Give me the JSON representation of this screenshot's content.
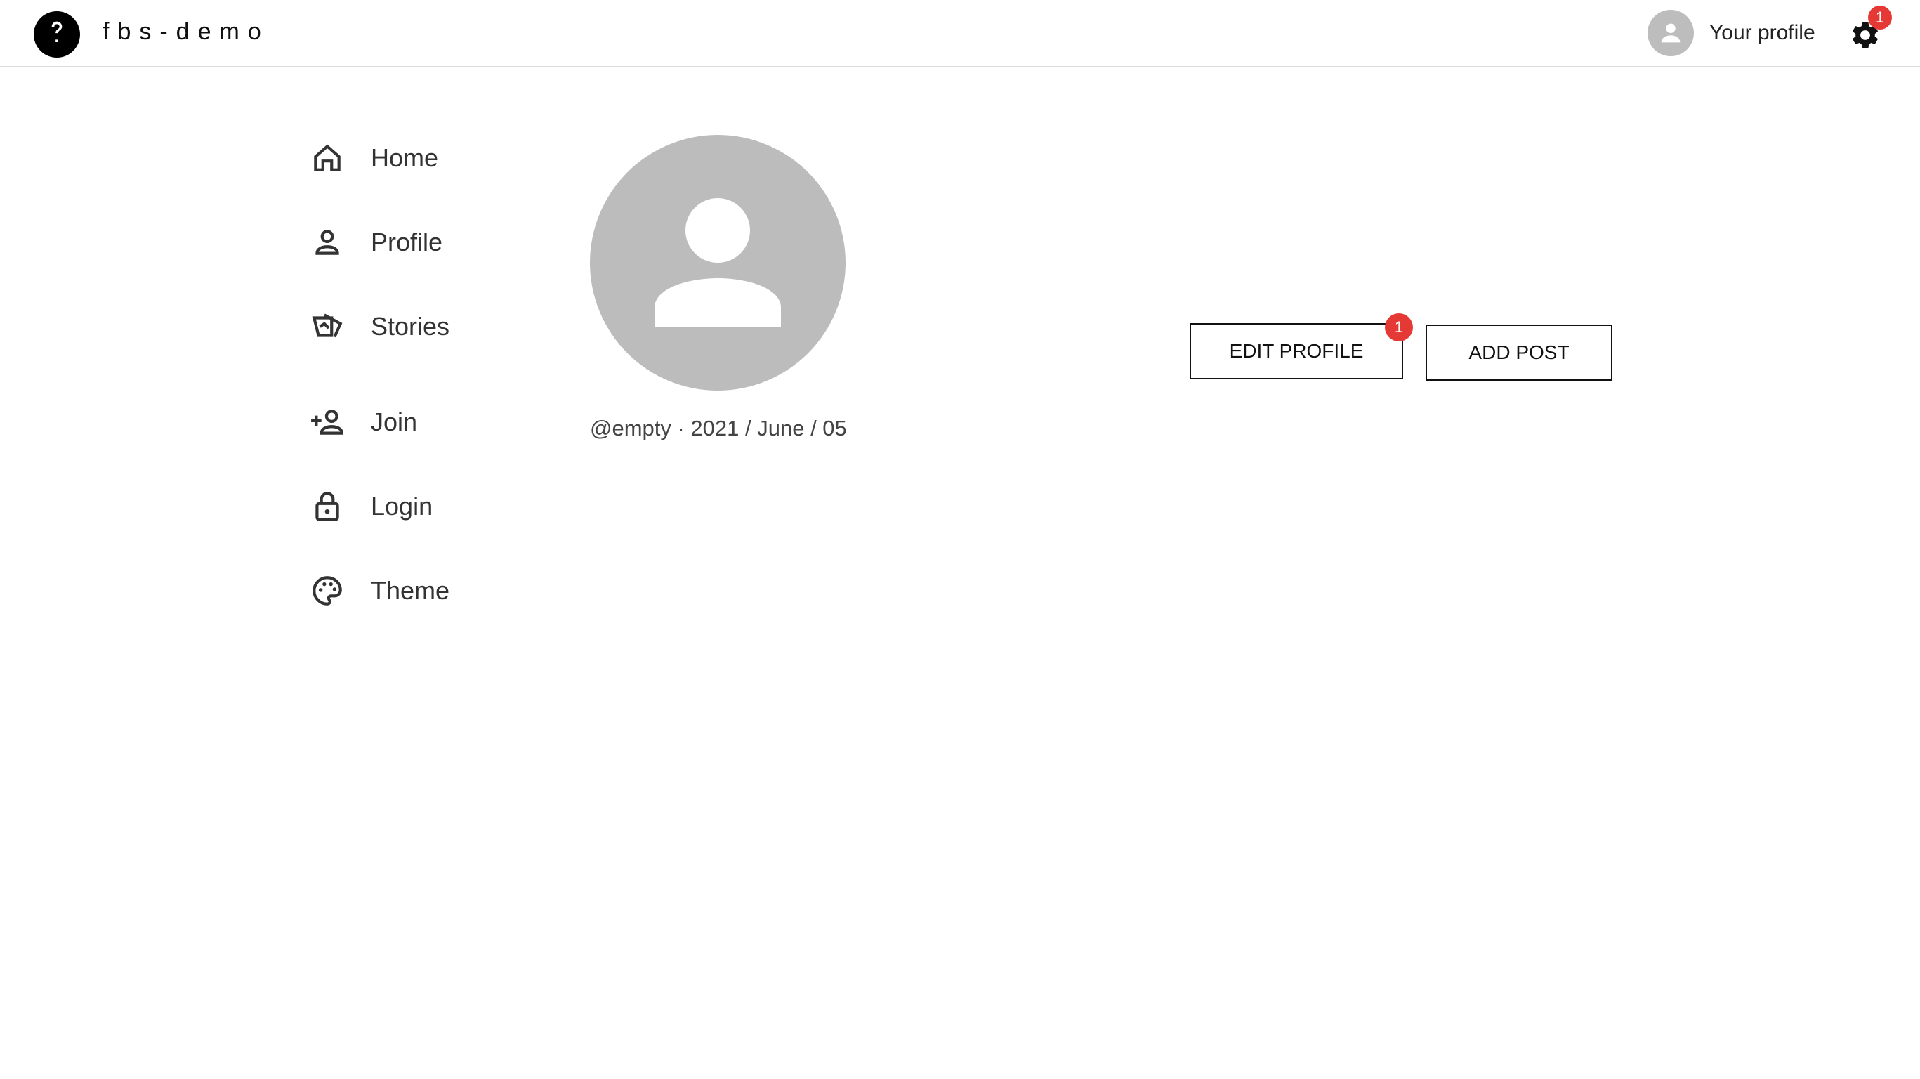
{
  "header": {
    "brand": "fbs-demo",
    "profile_label": "Your profile",
    "settings_badge": "1"
  },
  "sidebar": {
    "items": [
      {
        "label": "Home",
        "icon": "home-icon"
      },
      {
        "label": "Profile",
        "icon": "person-icon"
      },
      {
        "label": "Stories",
        "icon": "stories-icon"
      },
      {
        "label": "Join",
        "icon": "person-add-icon"
      },
      {
        "label": "Login",
        "icon": "lock-icon"
      },
      {
        "label": "Theme",
        "icon": "palette-icon"
      }
    ]
  },
  "profile": {
    "handle_date": "@empty · 2021 / June / 05"
  },
  "actions": {
    "edit_label": "EDIT PROFILE",
    "edit_badge": "1",
    "add_label": "ADD POST"
  },
  "colors": {
    "badge": "#e53935",
    "avatar": "#bcbcbc"
  }
}
